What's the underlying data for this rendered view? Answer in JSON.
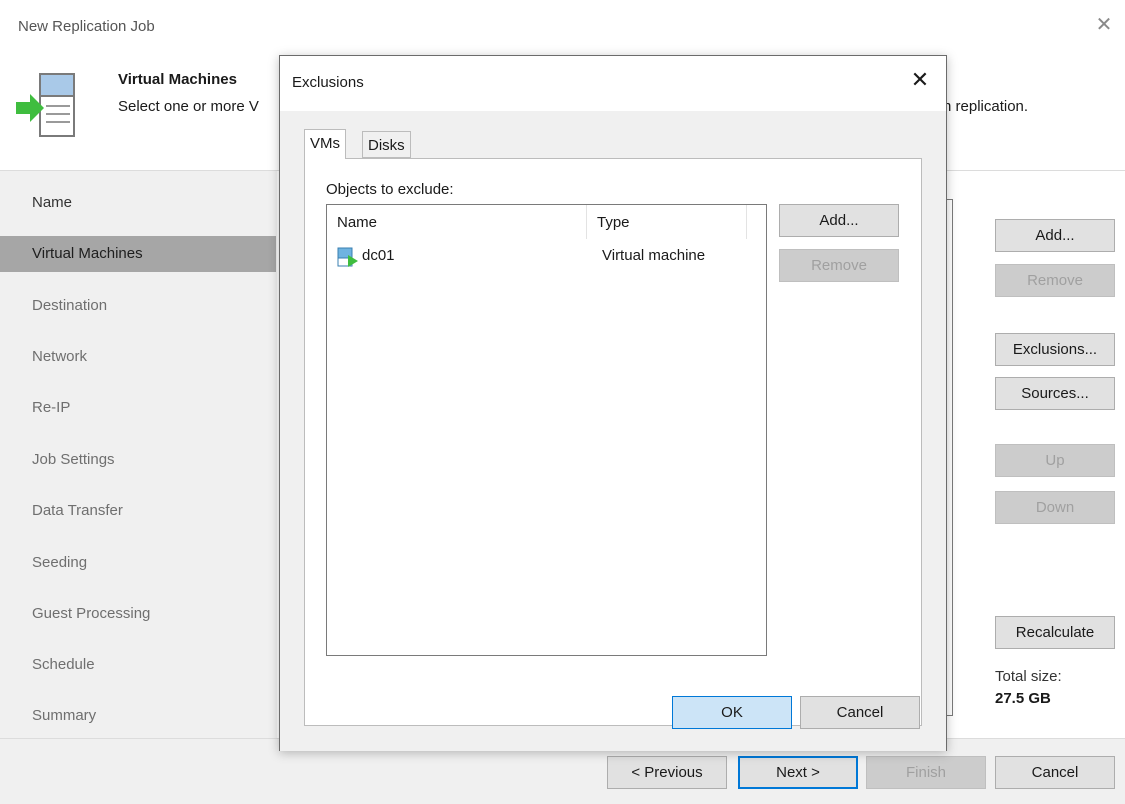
{
  "window": {
    "title": "New Replication Job",
    "close_glyph": "✕"
  },
  "header": {
    "icon": "vm-arrow-icon",
    "title": "Virtual Machines",
    "description": "Select one or more V",
    "description_tail": "n replication."
  },
  "nav": {
    "items": [
      {
        "label": "Name"
      },
      {
        "label": "Virtual Machines"
      },
      {
        "label": "Destination"
      },
      {
        "label": "Network"
      },
      {
        "label": "Re-IP"
      },
      {
        "label": "Job Settings"
      },
      {
        "label": "Data Transfer"
      },
      {
        "label": "Seeding"
      },
      {
        "label": "Guest Processing"
      },
      {
        "label": "Schedule"
      },
      {
        "label": "Summary"
      }
    ]
  },
  "side_buttons": {
    "add": "Add...",
    "remove": "Remove",
    "exclusions": "Exclusions...",
    "sources": "Sources...",
    "up": "Up",
    "down": "Down",
    "recalculate": "Recalculate"
  },
  "total": {
    "label": "Total size:",
    "value": "27.5 GB"
  },
  "footer": {
    "previous": "< Previous",
    "next": "Next >",
    "finish": "Finish",
    "cancel": "Cancel"
  },
  "dialog": {
    "title": "Exclusions",
    "close_glyph": "✕",
    "tabs": [
      {
        "label": "VMs"
      },
      {
        "label": "Disks"
      }
    ],
    "objects_label": "Objects to exclude:",
    "columns": {
      "name": "Name",
      "type": "Type"
    },
    "rows": [
      {
        "icon": "virtual-machine-icon",
        "name": "dc01",
        "type": "Virtual machine"
      }
    ],
    "add": "Add...",
    "remove": "Remove",
    "ok": "OK",
    "cancel": "Cancel"
  },
  "colors": {
    "accent": "#0078d7",
    "nav_active": "#a6a6a6",
    "arrow_green": "#3fbd3f"
  }
}
